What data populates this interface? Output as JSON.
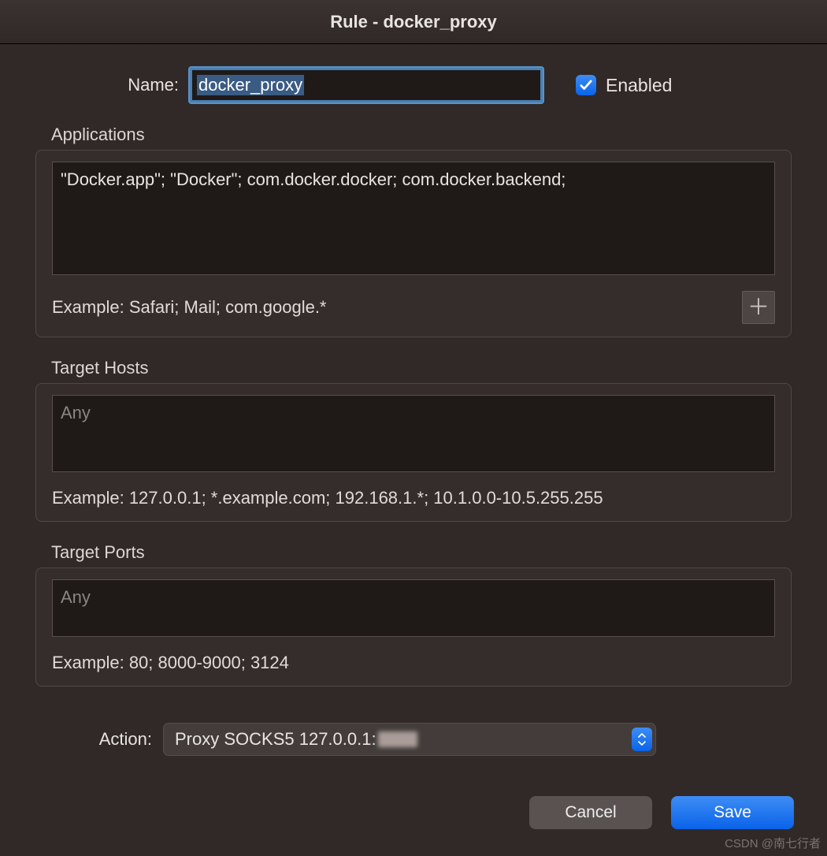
{
  "window": {
    "title": "Rule - docker_proxy"
  },
  "name": {
    "label": "Name:",
    "value": "docker_proxy"
  },
  "enabled": {
    "checked": true,
    "label": "Enabled"
  },
  "applications": {
    "section_label": "Applications",
    "value": "\"Docker.app\"; \"Docker\"; com.docker.docker; com.docker.backend;",
    "example": "Example: Safari; Mail; com.google.*",
    "add_icon": "plus-icon"
  },
  "target_hosts": {
    "section_label": "Target Hosts",
    "placeholder": "Any",
    "value": "",
    "example": "Example: 127.0.0.1; *.example.com; 192.168.1.*; 10.1.0.0-10.5.255.255"
  },
  "target_ports": {
    "section_label": "Target Ports",
    "placeholder": "Any",
    "value": "",
    "example": "Example: 80; 8000-9000; 3124"
  },
  "action": {
    "label": "Action:",
    "value": "Proxy SOCKS5 127.0.0.1:"
  },
  "buttons": {
    "cancel": "Cancel",
    "save": "Save"
  },
  "watermark": "CSDN @南七行者"
}
